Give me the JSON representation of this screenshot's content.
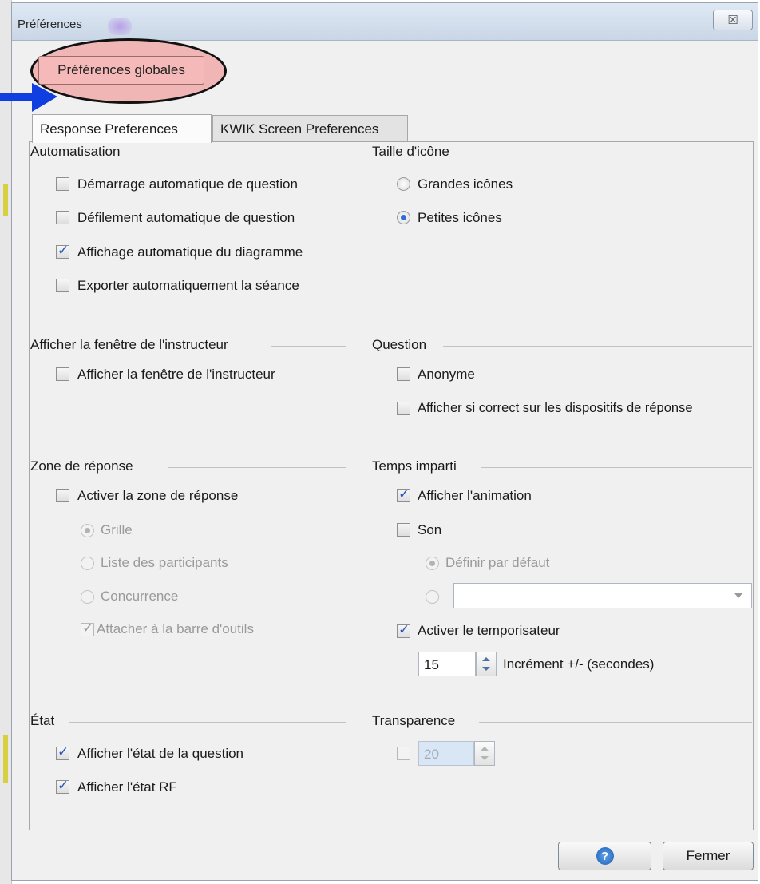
{
  "window": {
    "title": "Préférences",
    "close_glyph": "☒"
  },
  "global_button": {
    "label": "Préférences globales",
    "highlight_color": "#f0b5b5"
  },
  "arrow": {
    "icon": "arrow-right-icon",
    "color": "#0f3fe0"
  },
  "tabs": [
    {
      "label": "Response Preferences",
      "active": true
    },
    {
      "label": "KWIK Screen Preferences",
      "active": false
    }
  ],
  "groups": {
    "automatisation": {
      "title": "Automatisation",
      "options": [
        {
          "label": "Démarrage automatique de question",
          "checked": false
        },
        {
          "label": "Défilement automatique de question",
          "checked": false
        },
        {
          "label": "Affichage automatique du diagramme",
          "checked": true
        },
        {
          "label": "Exporter automatiquement la séance",
          "checked": false
        }
      ]
    },
    "taille_icone": {
      "title": "Taille d'icône",
      "options": [
        {
          "label": "Grandes icônes",
          "selected": false
        },
        {
          "label": "Petites icônes",
          "selected": true
        }
      ]
    },
    "instructeur": {
      "title": "Afficher la fenêtre de l'instructeur",
      "options": [
        {
          "label": "Afficher la fenêtre de l'instructeur",
          "checked": false
        }
      ]
    },
    "question": {
      "title": "Question",
      "options": [
        {
          "label": "Anonyme",
          "checked": false
        },
        {
          "label": "Afficher si correct sur les dispositifs de réponse",
          "checked": false
        }
      ]
    },
    "zone_reponse": {
      "title": "Zone de réponse",
      "enable_label": "Activer la zone de réponse",
      "enable_checked": false,
      "radios": [
        {
          "label": "Grille",
          "selected": true
        },
        {
          "label": "Liste des participants",
          "selected": false
        },
        {
          "label": "Concurrence",
          "selected": false
        }
      ],
      "attach_label": "Attacher à la barre d'outils",
      "attach_checked": true
    },
    "temps_imparti": {
      "title": "Temps imparti",
      "animation_label": "Afficher l'animation",
      "animation_checked": true,
      "sound_label": "Son",
      "sound_checked": false,
      "default_label": "Définir par défaut",
      "default_selected": true,
      "custom_selected": false,
      "custom_value": "",
      "timer_label": "Activer le temporisateur",
      "timer_checked": true,
      "increment_value": "15",
      "increment_label": "Incrément +/- (secondes)"
    },
    "etat": {
      "title": "État",
      "options": [
        {
          "label": "Afficher l'état de la question",
          "checked": true
        },
        {
          "label": "Afficher l'état RF",
          "checked": true
        }
      ]
    },
    "transparence": {
      "title": "Transparence",
      "enabled": false,
      "value": "20"
    }
  },
  "footer": {
    "help_icon": "help-icon",
    "help_glyph": "?",
    "close_label": "Fermer"
  }
}
